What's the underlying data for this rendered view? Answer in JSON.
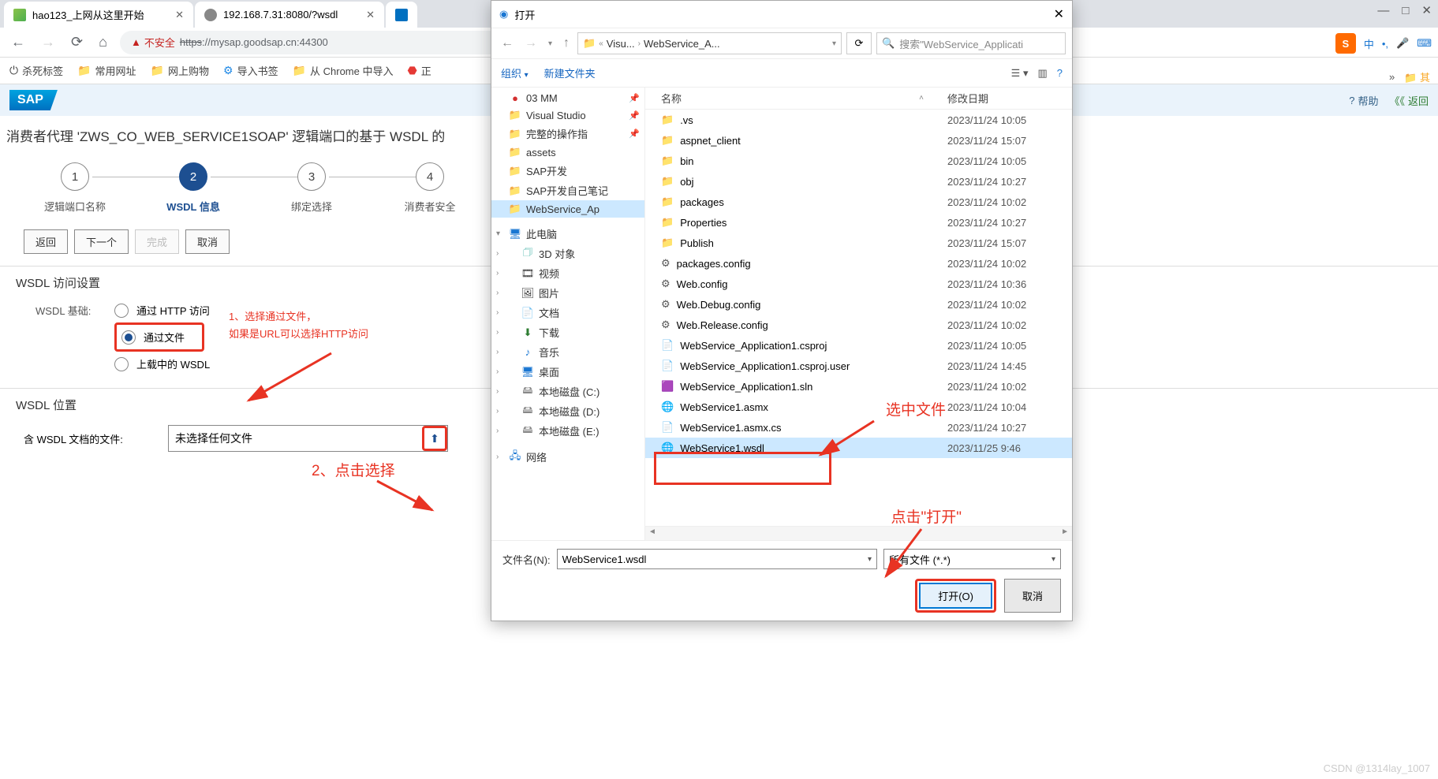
{
  "tabs": [
    {
      "title": "hao123_上网从这里开始"
    },
    {
      "title": "192.168.7.31:8080/?wsdl"
    }
  ],
  "address": {
    "insecure_label": "不安全",
    "scheme": "https",
    "host": "://mysap.goodsap.cn",
    "port": ":44300"
  },
  "bookmarks": {
    "kill": "杀死标签",
    "common": "常用网址",
    "shop": "网上购物",
    "import": "导入书签",
    "chrome": "从 Chrome 中导入"
  },
  "sap": {
    "help": "帮助",
    "back": "返回"
  },
  "page_title": "消费者代理 'ZWS_CO_WEB_SERVICE1SOAP' 逻辑端口的基于 WSDL 的",
  "steps": {
    "s1": "逻辑端口名称",
    "s2": "WSDL 信息",
    "s3": "绑定选择",
    "s4": "消费者安全"
  },
  "buttons": {
    "back": "返回",
    "next": "下一个",
    "finish": "完成",
    "cancel": "取消"
  },
  "form": {
    "section1": "WSDL 访问设置",
    "basis": "WSDL 基础:",
    "r1": "通过 HTTP 访问",
    "r2": "通过文件",
    "r3": "上载中的 WSDL",
    "section2": "WSDL 位置",
    "file_lbl": "含 WSDL 文档的文件:",
    "file_ph": "未选择任何文件"
  },
  "annot": {
    "a1": "1、选择通过文件，",
    "a1b": "如果是URL可以选择HTTP访问",
    "a2": "2、点击选择",
    "a3": "选中文件",
    "a4": "点击\"打开\""
  },
  "dialog": {
    "title": "打开",
    "path_visu": "Visu...",
    "path_ws": "WebService_A...",
    "search_ph": "搜索\"WebService_Applicati",
    "organize": "组织",
    "newfolder": "新建文件夹",
    "col_name": "名称",
    "col_date": "修改日期",
    "tree": {
      "mm": "03 MM",
      "vs": "Visual Studio",
      "ops": "完整的操作指",
      "assets": "assets",
      "sapdev": "SAP开发",
      "sapnotes": "SAP开发自己笔记",
      "wsapp": "WebService_Ap",
      "pc": "此电脑",
      "d3": "3D 对象",
      "video": "视频",
      "pic": "图片",
      "doc": "文档",
      "dl": "下载",
      "music": "音乐",
      "desk": "桌面",
      "dc": "本地磁盘 (C:)",
      "dd": "本地磁盘 (D:)",
      "de": "本地磁盘 (E:)",
      "net": "网络"
    },
    "files": [
      {
        "n": ".vs",
        "d": "2023/11/24 10:05",
        "t": "folder"
      },
      {
        "n": "aspnet_client",
        "d": "2023/11/24 15:07",
        "t": "folder"
      },
      {
        "n": "bin",
        "d": "2023/11/24 10:05",
        "t": "folder"
      },
      {
        "n": "obj",
        "d": "2023/11/24 10:27",
        "t": "folder"
      },
      {
        "n": "packages",
        "d": "2023/11/24 10:02",
        "t": "folder"
      },
      {
        "n": "Properties",
        "d": "2023/11/24 10:27",
        "t": "folder"
      },
      {
        "n": "Publish",
        "d": "2023/11/24 15:07",
        "t": "folder"
      },
      {
        "n": "packages.config",
        "d": "2023/11/24 10:02",
        "t": "cfg"
      },
      {
        "n": "Web.config",
        "d": "2023/11/24 10:36",
        "t": "cfg"
      },
      {
        "n": "Web.Debug.config",
        "d": "2023/11/24 10:02",
        "t": "cfg"
      },
      {
        "n": "Web.Release.config",
        "d": "2023/11/24 10:02",
        "t": "cfg"
      },
      {
        "n": "WebService_Application1.csproj",
        "d": "2023/11/24 10:05",
        "t": "proj"
      },
      {
        "n": "WebService_Application1.csproj.user",
        "d": "2023/11/24 14:45",
        "t": "proj"
      },
      {
        "n": "WebService_Application1.sln",
        "d": "2023/11/24 10:02",
        "t": "sln"
      },
      {
        "n": "WebService1.asmx",
        "d": "2023/11/24 10:04",
        "t": "web"
      },
      {
        "n": "WebService1.asmx.cs",
        "d": "2023/11/24 10:27",
        "t": "cs"
      },
      {
        "n": "WebService1.wsdl",
        "d": "2023/11/25 9:46",
        "t": "web"
      }
    ],
    "filename_lbl": "文件名(N):",
    "filename_val": "WebService1.wsdl",
    "filter": "所有文件 (*.*)",
    "open": "打开(O)",
    "cancel": "取消"
  },
  "right_icons": {
    "cn": "中"
  },
  "watermark": "CSDN @1314lay_1007"
}
